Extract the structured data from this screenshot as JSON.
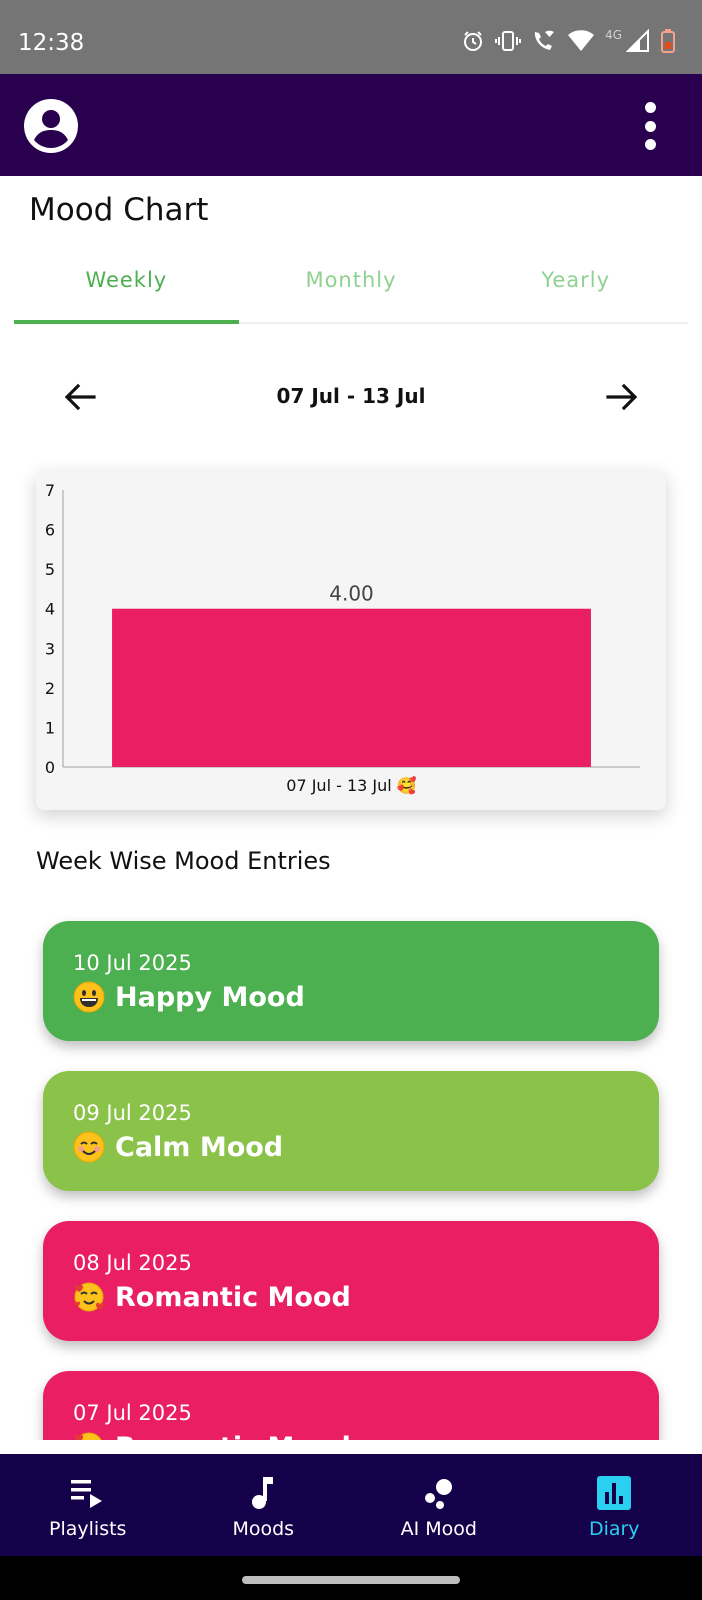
{
  "status_bar": {
    "time": "12:38",
    "network_label": "4G",
    "icons": [
      "alarm-icon",
      "vibrate-icon",
      "wifi-call-icon",
      "wifi-icon",
      "signal-icon",
      "battery-icon"
    ]
  },
  "app_bar": {
    "icons": [
      "account-icon",
      "more-vert-icon"
    ],
    "background": "#29004d"
  },
  "page": {
    "title": "Mood Chart"
  },
  "tabs": [
    {
      "label": "Weekly",
      "active": true
    },
    {
      "label": "Monthly",
      "active": false
    },
    {
      "label": "Yearly",
      "active": false
    }
  ],
  "week_nav": {
    "label": "07 Jul - 13 Jul",
    "icons": [
      "arrow-left-icon",
      "arrow-right-icon"
    ]
  },
  "chart_data": {
    "type": "bar",
    "categories": [
      "07 Jul - 13 Jul 🥰"
    ],
    "values": [
      4.0
    ],
    "data_labels": [
      "4.00"
    ],
    "ylim": [
      0,
      7
    ],
    "y_ticks": [
      "0",
      "1",
      "2",
      "3",
      "4",
      "5",
      "6",
      "7"
    ],
    "bar_color": "#e91e63",
    "grid": false
  },
  "entries_section": {
    "title": "Week Wise Mood Entries",
    "items": [
      {
        "date": "10 Jul 2025",
        "mood": "Happy Mood",
        "emoji_icon": "grinning-face-icon",
        "color": "#4caf50"
      },
      {
        "date": "09 Jul 2025",
        "mood": "Calm Mood",
        "emoji_icon": "smiling-face-icon",
        "color": "#8bc34a"
      },
      {
        "date": "08 Jul 2025",
        "mood": "Romantic Mood",
        "emoji_icon": "hearts-face-icon",
        "color": "#e91e63"
      },
      {
        "date": "07 Jul 2025",
        "mood": "Romantic Mood",
        "emoji_icon": "hearts-face-icon",
        "color": "#e91e63"
      }
    ]
  },
  "bottom_nav": {
    "items": [
      {
        "label": "Playlists",
        "icon": "playlist-icon",
        "active": false
      },
      {
        "label": "Moods",
        "icon": "music-note-icon",
        "active": false
      },
      {
        "label": "AI Mood",
        "icon": "bubbles-icon",
        "active": false
      },
      {
        "label": "Diary",
        "icon": "bar-chart-icon",
        "active": true
      }
    ],
    "active_color": "#29d0f0"
  }
}
